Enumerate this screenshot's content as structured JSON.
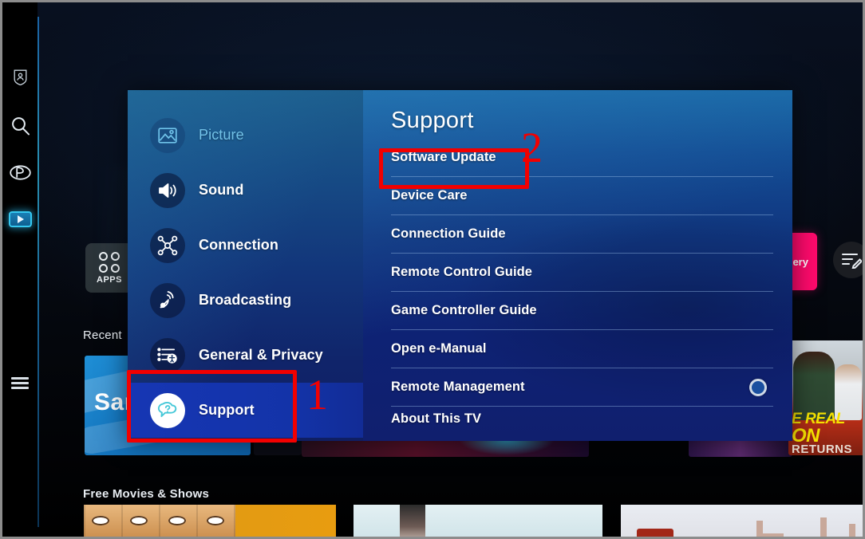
{
  "tv": {
    "rail": {
      "items": [
        {
          "name": "profile-icon",
          "label": "Profile"
        },
        {
          "name": "search-icon",
          "label": "Search"
        },
        {
          "name": "ambient-icon",
          "label": "Ambient Mode"
        },
        {
          "name": "media-icon",
          "label": "Media"
        },
        {
          "name": "menu-icon",
          "label": "Menu"
        }
      ]
    },
    "home": {
      "apps_label": "APPS",
      "recent_title": "Recent",
      "free_title": "Free Movies & Shows",
      "samsung_tile_text": "Sam",
      "gallery_tile_text": "allery",
      "poster": {
        "line1": "E REAL",
        "line2": "ON",
        "line3": "RETURNS"
      },
      "edit_icon": "edit-list-icon"
    }
  },
  "settings": {
    "categories": [
      {
        "label": "Picture",
        "icon": "picture-icon",
        "state": "muted"
      },
      {
        "label": "Sound",
        "icon": "sound-icon",
        "state": "normal"
      },
      {
        "label": "Connection",
        "icon": "connection-icon",
        "state": "normal"
      },
      {
        "label": "Broadcasting",
        "icon": "broadcasting-icon",
        "state": "normal"
      },
      {
        "label": "General & Privacy",
        "icon": "general-privacy-icon",
        "state": "normal"
      },
      {
        "label": "Support",
        "icon": "support-icon",
        "state": "selected"
      }
    ],
    "panel_title": "Support",
    "options": [
      {
        "label": "Software Update",
        "highlighted": true,
        "toggle": false
      },
      {
        "label": "Device Care",
        "highlighted": false,
        "toggle": false
      },
      {
        "label": "Connection Guide",
        "highlighted": false,
        "toggle": false
      },
      {
        "label": "Remote Control Guide",
        "highlighted": false,
        "toggle": false
      },
      {
        "label": "Game Controller Guide",
        "highlighted": false,
        "toggle": false
      },
      {
        "label": "Open e-Manual",
        "highlighted": false,
        "toggle": false
      },
      {
        "label": "Remote Management",
        "highlighted": false,
        "toggle": true
      },
      {
        "label": "About This TV",
        "highlighted": false,
        "toggle": false,
        "clipped": true
      }
    ]
  },
  "annotations": {
    "color": "#f20000",
    "markers": [
      {
        "id": "1",
        "target": "Support"
      },
      {
        "id": "2",
        "target": "Software Update"
      }
    ]
  }
}
